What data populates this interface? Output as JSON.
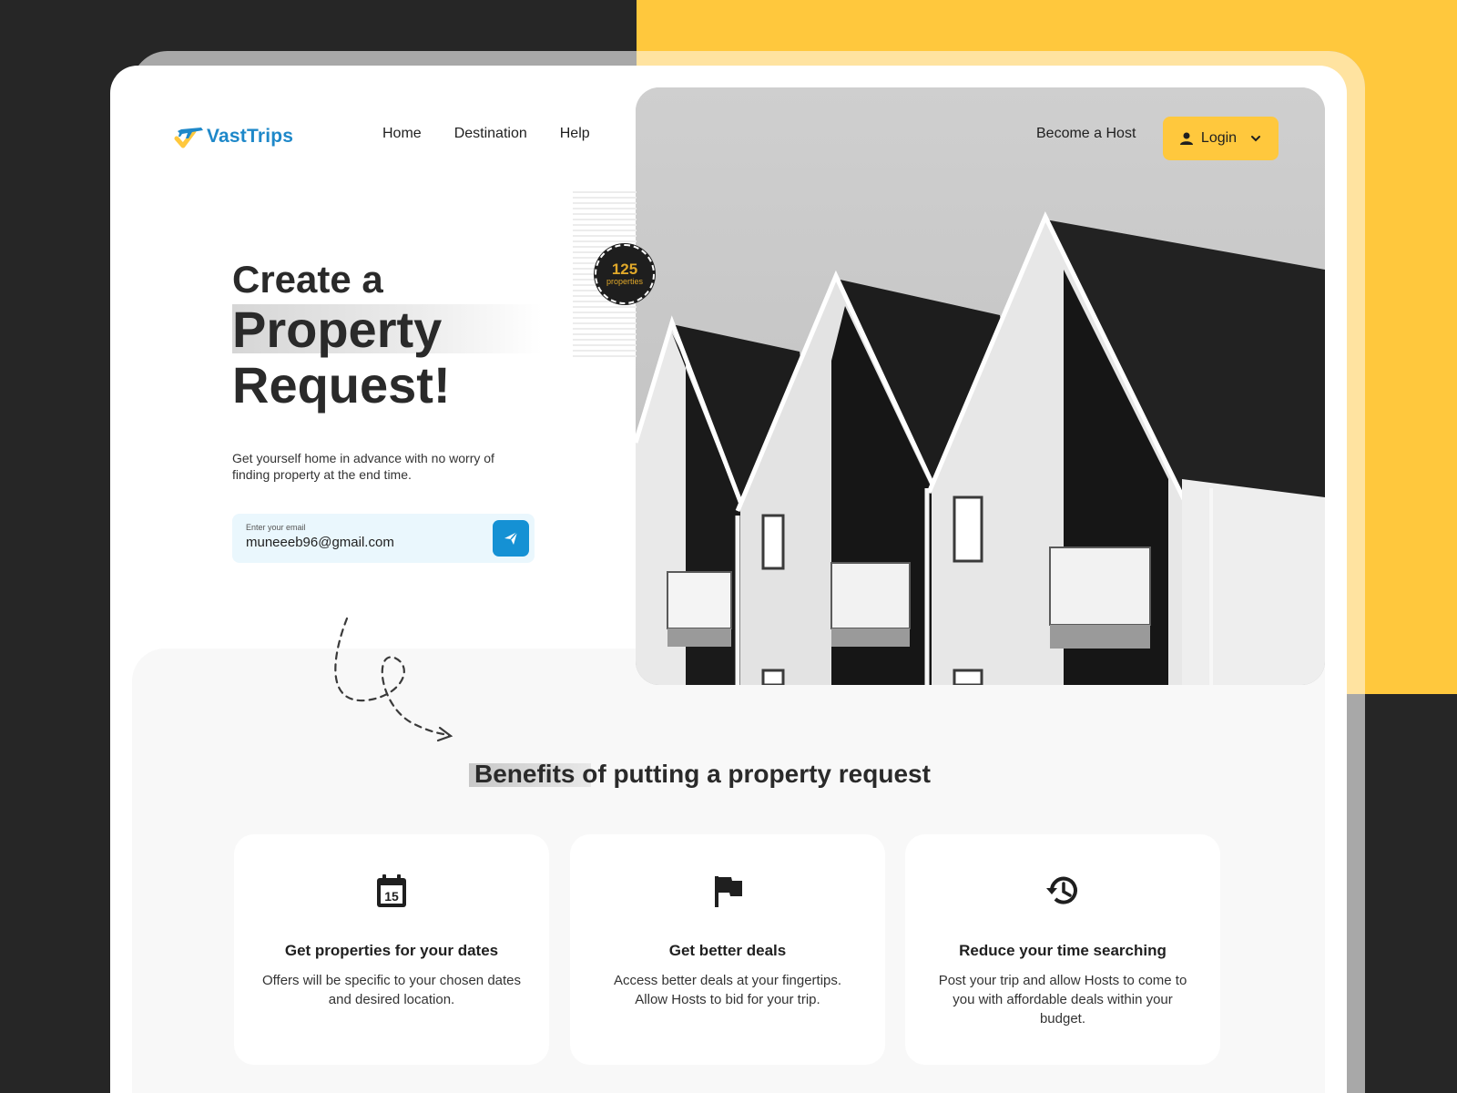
{
  "brand": {
    "name": "VastTrips"
  },
  "nav": {
    "items": [
      "Home",
      "Destination",
      "Help"
    ]
  },
  "header": {
    "become_host": "Become a Host",
    "login_label": "Login"
  },
  "badge": {
    "count": "125",
    "label": "properties"
  },
  "hero": {
    "title_line1": "Create a",
    "title_line2": "Property",
    "title_line3": "Request!",
    "subtext": "Get yourself home in advance with no worry of finding property at the end time."
  },
  "email": {
    "label": "Enter your email",
    "value": "muneeeb96@gmail.com"
  },
  "benefits": {
    "title_highlight": "Benefits",
    "title_rest": " of putting a property request",
    "cards": [
      {
        "icon": "calendar-icon",
        "icon_text": "15",
        "title": "Get properties for your dates",
        "text": "Offers will be specific to your chosen dates and desired location."
      },
      {
        "icon": "flag-icon",
        "title": "Get better deals",
        "text": "Access better deals at your fingertips. Allow Hosts to bid for your trip."
      },
      {
        "icon": "history-icon",
        "title": "Reduce your time searching",
        "text": "Post your trip and allow Hosts to come to you with affordable deals within your budget."
      }
    ]
  },
  "colors": {
    "accent": "#ffc83d",
    "primary": "#1591d4",
    "dark": "#262626",
    "email_bg": "#eaf7fd"
  }
}
